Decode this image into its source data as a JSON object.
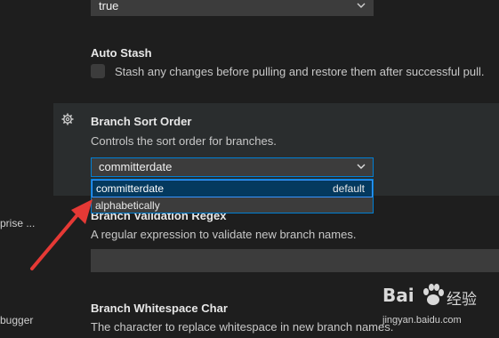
{
  "sidebar": {
    "fragments": [
      "prise ...",
      "bugger"
    ]
  },
  "top_select": {
    "value": "true"
  },
  "auto_stash": {
    "title": "Auto Stash",
    "description": "Stash any changes before pulling and restore them after successful pull."
  },
  "branch_sort_order": {
    "title": "Branch Sort Order",
    "description": "Controls the sort order for branches.",
    "value": "committerdate",
    "options": [
      {
        "label": "committerdate",
        "tag": "default"
      },
      {
        "label": "alphabetically",
        "tag": ""
      }
    ]
  },
  "branch_validation_regex": {
    "title": "Branch Validation Regex",
    "description": "A regular expression to validate new branch names."
  },
  "branch_whitespace_char": {
    "title": "Branch Whitespace Char",
    "description": "The character to replace whitespace in new branch names."
  },
  "watermark": {
    "logo": "Bai",
    "cn": "经验",
    "url": "jingyan.baidu.com"
  },
  "colors": {
    "background": "#1e1e1e",
    "focused_row": "#2a2d2e",
    "input": "#3c3c3c",
    "focus_border": "#007fd4",
    "selected_option": "#04395e",
    "annotation_arrow": "#e53935"
  },
  "icons": [
    "chevron-down-icon",
    "gear-icon",
    "baidu-paw-icon"
  ]
}
